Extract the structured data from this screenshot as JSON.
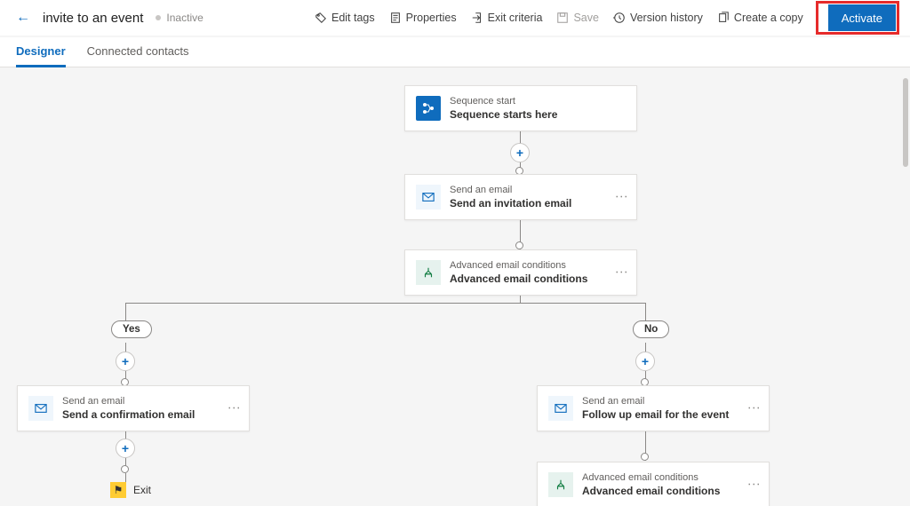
{
  "toolbar": {
    "title": "invite to an event",
    "status": "Inactive",
    "editTags": "Edit tags",
    "properties": "Properties",
    "exitCriteria": "Exit criteria",
    "save": "Save",
    "versionHistory": "Version history",
    "createCopy": "Create a copy",
    "activate": "Activate"
  },
  "tabs": {
    "designer": "Designer",
    "connected": "Connected contacts"
  },
  "nodes": {
    "start": {
      "t1": "Sequence start",
      "t2": "Sequence starts here"
    },
    "send1": {
      "t1": "Send an email",
      "t2": "Send an invitation email"
    },
    "cond1": {
      "t1": "Advanced email conditions",
      "t2": "Advanced email conditions"
    },
    "send2": {
      "t1": "Send an email",
      "t2": "Send a confirmation email"
    },
    "send3": {
      "t1": "Send an email",
      "t2": "Follow up email for the event"
    },
    "cond2": {
      "t1": "Advanced email conditions",
      "t2": "Advanced email conditions"
    }
  },
  "branches": {
    "yes": "Yes",
    "no": "No"
  },
  "exit": "Exit"
}
